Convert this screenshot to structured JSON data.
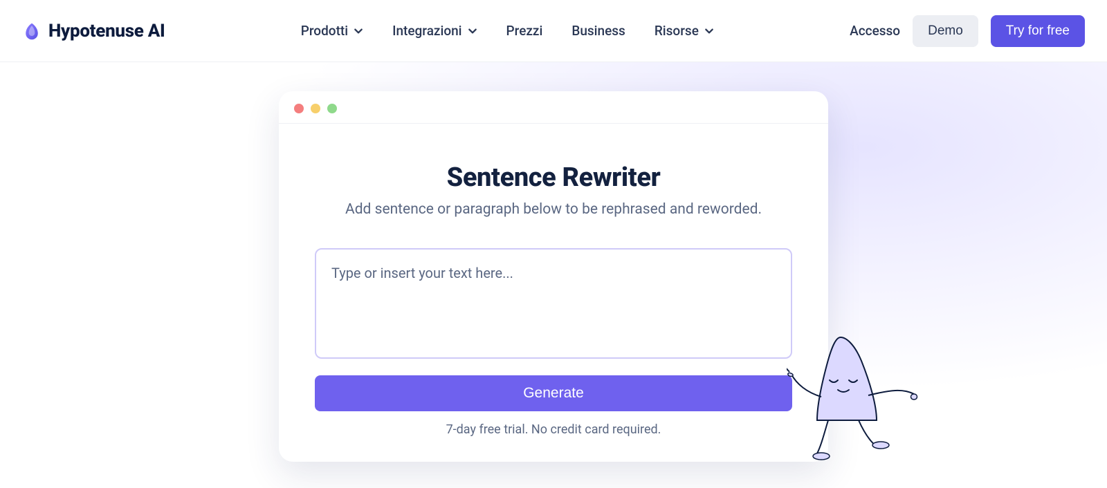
{
  "brand": {
    "name": "Hypotenuse AI"
  },
  "nav": {
    "items": [
      {
        "label": "Prodotti",
        "hasMenu": true
      },
      {
        "label": "Integrazioni",
        "hasMenu": true
      },
      {
        "label": "Prezzi",
        "hasMenu": false
      },
      {
        "label": "Business",
        "hasMenu": false
      },
      {
        "label": "Risorse",
        "hasMenu": true
      }
    ]
  },
  "actions": {
    "login": "Accesso",
    "demo": "Demo",
    "cta": "Try for free"
  },
  "tool": {
    "title": "Sentence Rewriter",
    "subtitle": "Add sentence or paragraph below to be rephrased and reworded.",
    "placeholder": "Type or insert your text here...",
    "generate": "Generate",
    "trial_note": "7-day free trial. No credit card required."
  },
  "colors": {
    "primary": "#5B53E5",
    "accent": "#6f61ee",
    "text": "#13213f",
    "muted": "#5a6782"
  }
}
